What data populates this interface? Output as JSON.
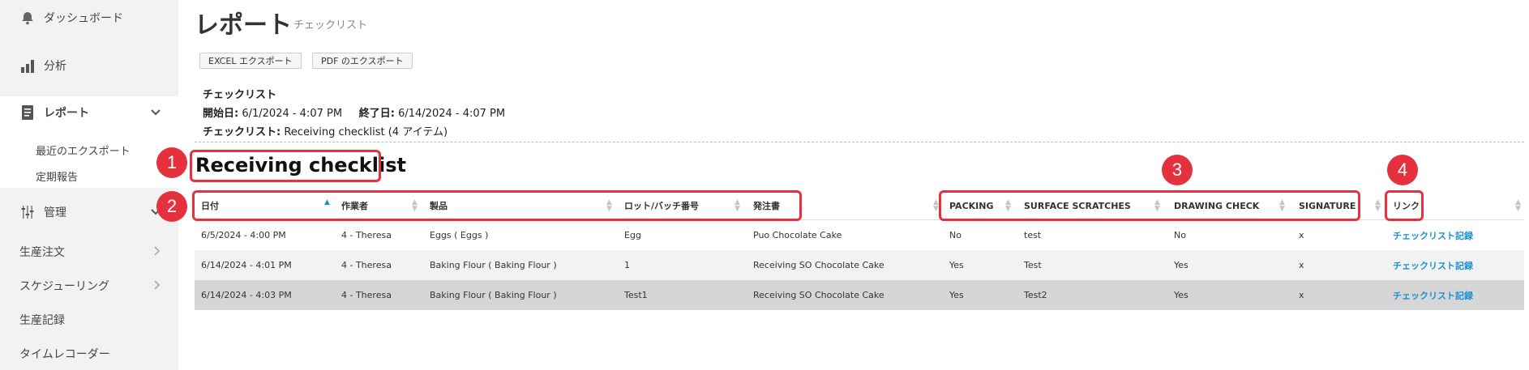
{
  "sidebar": {
    "dashboard": "ダッシュボード",
    "analytics": "分析",
    "reports": "レポート",
    "reports_sub": [
      "最近のエクスポート",
      "定期報告"
    ],
    "management": "管理",
    "production_orders": "生産注文",
    "scheduling": "スケジューリング",
    "production_records": "生産記録",
    "time_recorder": "タイムレコーダー"
  },
  "header": {
    "title": "レポート",
    "subtitle": "チェックリスト"
  },
  "actions": {
    "excel_export": "EXCEL エクスポート",
    "pdf_export": "PDF のエクスポート"
  },
  "info": {
    "heading": "チェックリスト",
    "start_label": "開始日:",
    "start_value": "6/1/2024 - 4:07 PM",
    "end_label": "終了日:",
    "end_value": "6/14/2024 - 4:07 PM",
    "checklist_label": "チェックリスト:",
    "checklist_value": "Receiving checklist (4 アイテム)"
  },
  "section_title": "Receiving checklist",
  "table": {
    "columns": [
      "日付",
      "作業者",
      "製品",
      "ロット/バッチ番号",
      "発注書",
      "PACKING",
      "SURFACE SCRATCHES",
      "DRAWING CHECK",
      "SIGNATURE",
      "リンク"
    ],
    "rows": [
      [
        "6/5/2024 - 4:00 PM",
        "4 - Theresa",
        "Eggs ( Eggs )",
        "Egg",
        "Puo Chocolate Cake",
        "No",
        "test",
        "No",
        "x",
        "チェックリスト記録"
      ],
      [
        "6/14/2024 - 4:01 PM",
        "4 - Theresa",
        "Baking Flour ( Baking Flour )",
        "1",
        "Receiving SO Chocolate Cake",
        "Yes",
        "Test",
        "Yes",
        "x",
        "チェックリスト記録"
      ],
      [
        "6/14/2024 - 4:03 PM",
        "4 - Theresa",
        "Baking Flour ( Baking Flour )",
        "Test1",
        "Receiving SO Chocolate Cake",
        "Yes",
        "Test2",
        "Yes",
        "x",
        "チェックリスト記録"
      ]
    ],
    "row_colors": [
      "#ffffff",
      "#f2f2f2",
      "#d6d6d6"
    ],
    "sorted_column": "日付",
    "sort_direction": "ascending"
  },
  "annotations": [
    "1",
    "2",
    "3",
    "4"
  ],
  "colors": {
    "annotation": "#e5313d",
    "link": "#1a8fd3",
    "sidebar_bg": "#f2f2f2"
  }
}
